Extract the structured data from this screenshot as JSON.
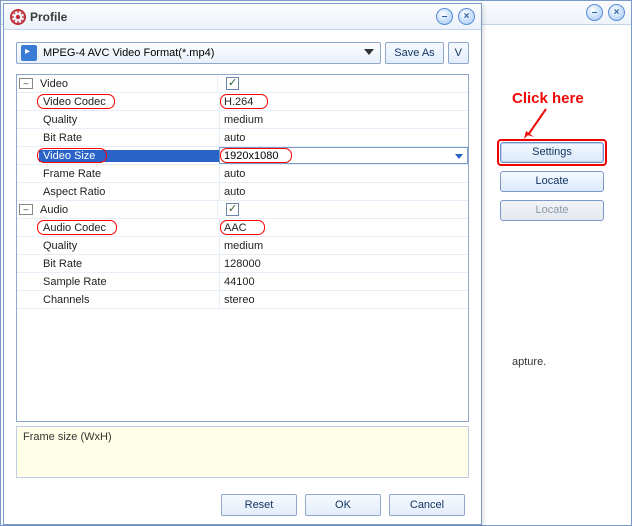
{
  "outer": {
    "minimize_glyph": "–",
    "close_glyph": "×",
    "help_glyph": "?"
  },
  "right_panel": {
    "click_here": "Click here",
    "settings": "Settings",
    "locate": "Locate",
    "locate_disabled": "Locate",
    "capture_fragment": "apture."
  },
  "profile": {
    "title": "Profile",
    "minimize_glyph": "–",
    "close_glyph": "×",
    "format_value": "MPEG-4 AVC Video Format(*.mp4)",
    "save_as": "Save As",
    "v_button": "V",
    "groups": {
      "video": {
        "label": "Video",
        "checked": true,
        "items": [
          {
            "label": "Video Codec",
            "value": "H.264",
            "highlight_label": true,
            "highlight_value": true
          },
          {
            "label": "Quality",
            "value": "medium"
          },
          {
            "label": "Bit Rate",
            "value": "auto"
          },
          {
            "label": "Video Size",
            "value": "1920x1080",
            "selected": true,
            "highlight_label": true,
            "highlight_value": true
          },
          {
            "label": "Frame Rate",
            "value": "auto"
          },
          {
            "label": "Aspect Ratio",
            "value": "auto"
          }
        ]
      },
      "audio": {
        "label": "Audio",
        "checked": true,
        "items": [
          {
            "label": "Audio Codec",
            "value": "AAC",
            "highlight_label": true,
            "highlight_value": true
          },
          {
            "label": "Quality",
            "value": "medium"
          },
          {
            "label": "Bit Rate",
            "value": "128000"
          },
          {
            "label": "Sample Rate",
            "value": "44100"
          },
          {
            "label": "Channels",
            "value": "stereo"
          }
        ]
      }
    },
    "description": "Frame size (WxH)",
    "buttons": {
      "reset": "Reset",
      "ok": "OK",
      "cancel": "Cancel"
    }
  }
}
